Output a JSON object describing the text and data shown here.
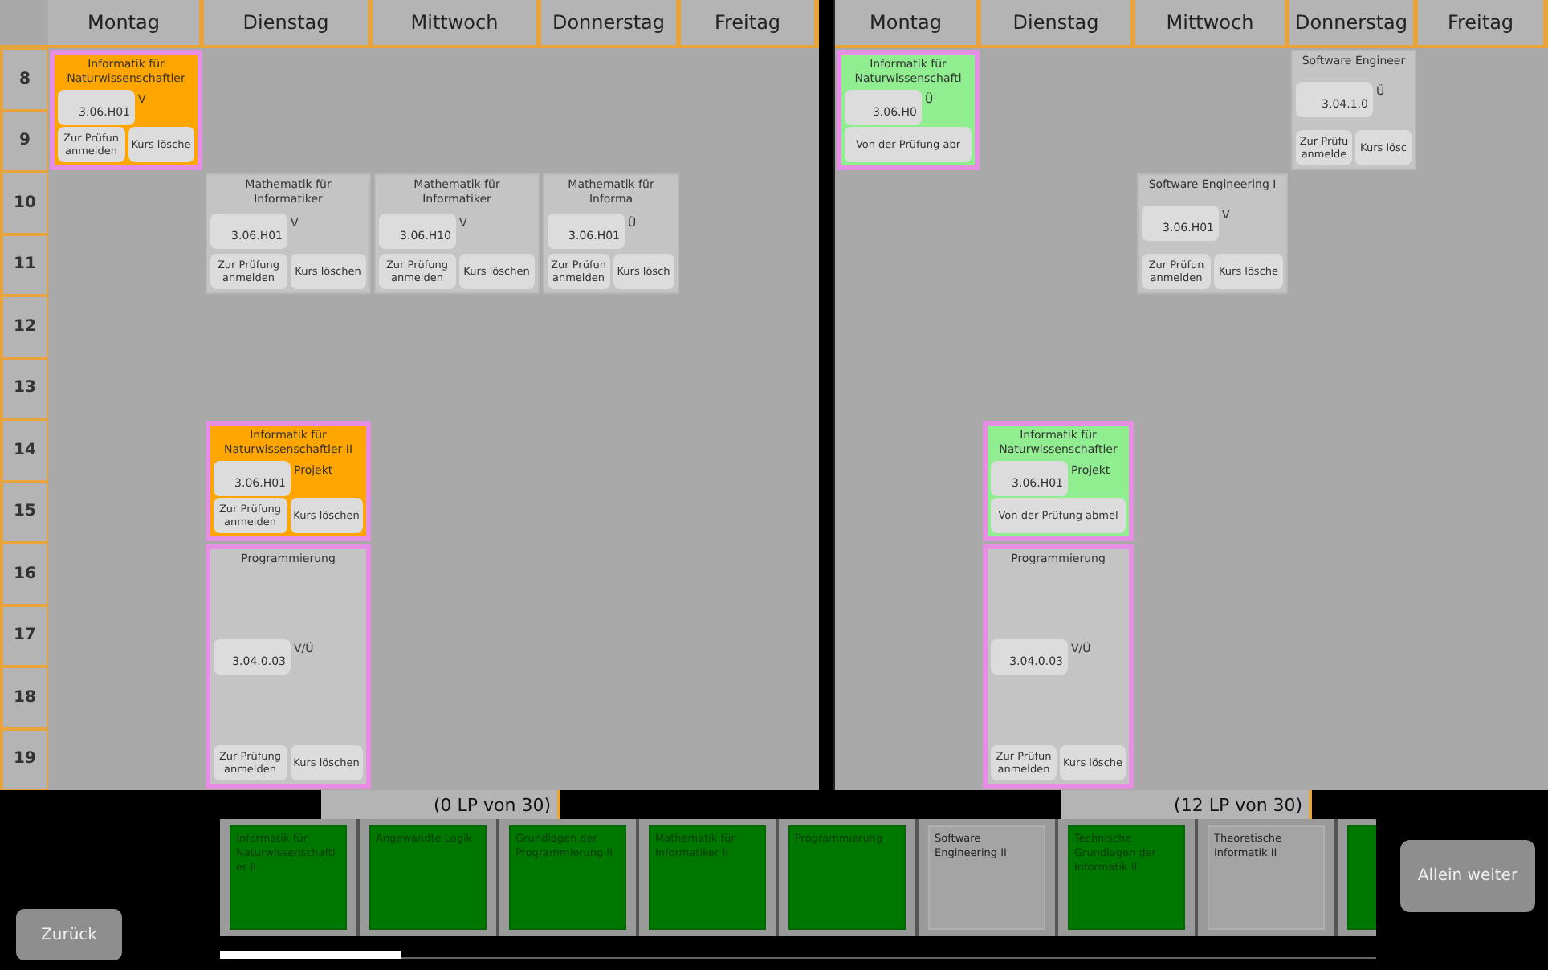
{
  "schedules": [
    {
      "hours": [
        "8",
        "9",
        "10",
        "11",
        "12",
        "13",
        "14",
        "15",
        "16",
        "17",
        "18",
        "19"
      ],
      "days": [
        {
          "label": "Montag",
          "slots": [
            {
              "kind": "course",
              "title": "Informatik für Naturwissenschaftler",
              "room": "3.06.H01",
              "type": "V",
              "color": "#ffa500",
              "highlighted": true,
              "buttons": [
                "Zur Prüfun anmelden",
                "Kurs lösche"
              ]
            },
            {
              "kind": "continued"
            }
          ]
        },
        {
          "label": "Dienstag",
          "slots": [
            {
              "kind": "empty"
            },
            {
              "kind": "empty"
            },
            {
              "kind": "course",
              "title": "Mathematik für Informatiker",
              "room": "3.06.H01",
              "type": "V",
              "color": "#c4c4c4",
              "highlighted": false,
              "buttons": [
                "Zur Prüfung anmelden",
                "Kurs löschen"
              ]
            },
            {
              "kind": "continued"
            },
            {
              "kind": "empty"
            },
            {
              "kind": "empty"
            },
            {
              "kind": "course",
              "title": "Informatik für Naturwissenschaftler II",
              "room": "3.06.H01",
              "type": "Projekt",
              "color": "#ffa500",
              "highlighted": true,
              "buttons": [
                "Zur Prüfung anmelden",
                "Kurs löschen"
              ]
            },
            {
              "kind": "continued"
            },
            {
              "kind": "course",
              "title": "Programmierung",
              "room": "3.04.0.03",
              "type": "V/Ü",
              "color": "#c4c4c4",
              "highlighted": true,
              "buttons": [
                "Zur Prüfung anmelden",
                "Kurs löschen"
              ]
            },
            {
              "kind": "continued"
            },
            {
              "kind": "continued"
            },
            {
              "kind": "continued"
            }
          ]
        },
        {
          "label": "Mittwoch",
          "slots": [
            {
              "kind": "empty"
            },
            {
              "kind": "empty"
            },
            {
              "kind": "course",
              "title": "Mathematik für Informatiker",
              "room": "3.06.H10",
              "type": "V",
              "color": "#c4c4c4",
              "highlighted": false,
              "buttons": [
                "Zur Prüfung anmelden",
                "Kurs löschen"
              ]
            },
            {
              "kind": "continued"
            }
          ]
        },
        {
          "label": "Donnerstag",
          "slots": [
            {
              "kind": "empty"
            },
            {
              "kind": "empty"
            },
            {
              "kind": "course",
              "title": "Mathematik für Informa",
              "room": "3.06.H01",
              "type": "Ü",
              "color": "#c4c4c4",
              "highlighted": false,
              "buttons": [
                "Zur Prüfun anmelden",
                "Kurs lösch"
              ]
            },
            {
              "kind": "continued"
            }
          ]
        },
        {
          "label": "Freitag"
        }
      ]
    },
    {
      "days": [
        {
          "label": "Montag",
          "slots": [
            {
              "kind": "course",
              "title": "Informatik für Naturwissenschaftl",
              "room": "3.06.H0",
              "type": "Ü",
              "color": "#90ee90",
              "highlighted": true,
              "buttons": [
                "Von der Prüfung abr"
              ]
            },
            {
              "kind": "continued"
            }
          ]
        },
        {
          "label": "Dienstag",
          "slots": [
            {
              "kind": "empty"
            },
            {
              "kind": "empty"
            },
            {
              "kind": "empty"
            },
            {
              "kind": "empty"
            },
            {
              "kind": "empty"
            },
            {
              "kind": "empty"
            },
            {
              "kind": "course",
              "title": "Informatik für Naturwissenschaftler",
              "room": "3.06.H01",
              "type": "Projekt",
              "color": "#90ee90",
              "highlighted": true,
              "buttons": [
                "Von der Prüfung abmel"
              ]
            },
            {
              "kind": "continued"
            },
            {
              "kind": "course",
              "title": "Programmierung",
              "room": "3.04.0.03",
              "type": "V/Ü",
              "color": "#c4c4c4",
              "highlighted": true,
              "buttons": [
                "Zur Prüfun anmelden",
                "Kurs lösche"
              ]
            },
            {
              "kind": "continued"
            },
            {
              "kind": "continued"
            },
            {
              "kind": "continued"
            }
          ]
        },
        {
          "label": "Mittwoch",
          "slots": [
            {
              "kind": "empty"
            },
            {
              "kind": "empty"
            },
            {
              "kind": "course",
              "title": "Software Engineering I",
              "room": "3.06.H01",
              "type": "V",
              "color": "#c4c4c4",
              "highlighted": false,
              "buttons": [
                "Zur Prüfun anmelden",
                "Kurs lösche"
              ]
            },
            {
              "kind": "continued"
            }
          ]
        },
        {
          "label": "Donnerstag",
          "slots": [
            {
              "kind": "course",
              "title": "Software Engineer",
              "room": "3.04.1.0",
              "type": "Ü",
              "color": "#c4c4c4",
              "highlighted": false,
              "buttons": [
                "Zur Prüfu anmelde",
                "Kurs lösc"
              ]
            },
            {
              "kind": "continued"
            }
          ]
        },
        {
          "label": "Freitag"
        }
      ]
    }
  ],
  "students": [
    {
      "credits": "(0 LP von 30)"
    },
    {
      "credits": "(12 LP von 30)"
    }
  ],
  "course_pool": [
    {
      "title": "Informatik für Naturwissenschaftler II",
      "done": true
    },
    {
      "title": "Angewandte Logik",
      "done": true
    },
    {
      "title": "Grundlagen der Programmierung II",
      "done": true
    },
    {
      "title": "Mathematik für Informatiker II",
      "done": true
    },
    {
      "title": "Programmierung",
      "done": true
    },
    {
      "title": "Software Engineering II",
      "done": false
    },
    {
      "title": "Technische Grundlagen der Informatik II",
      "done": true
    },
    {
      "title": "Theoretische Informatik II",
      "done": false
    },
    {
      "done": true
    }
  ],
  "buttons": {
    "back": "Zurück",
    "continue": "Allein weiter"
  }
}
